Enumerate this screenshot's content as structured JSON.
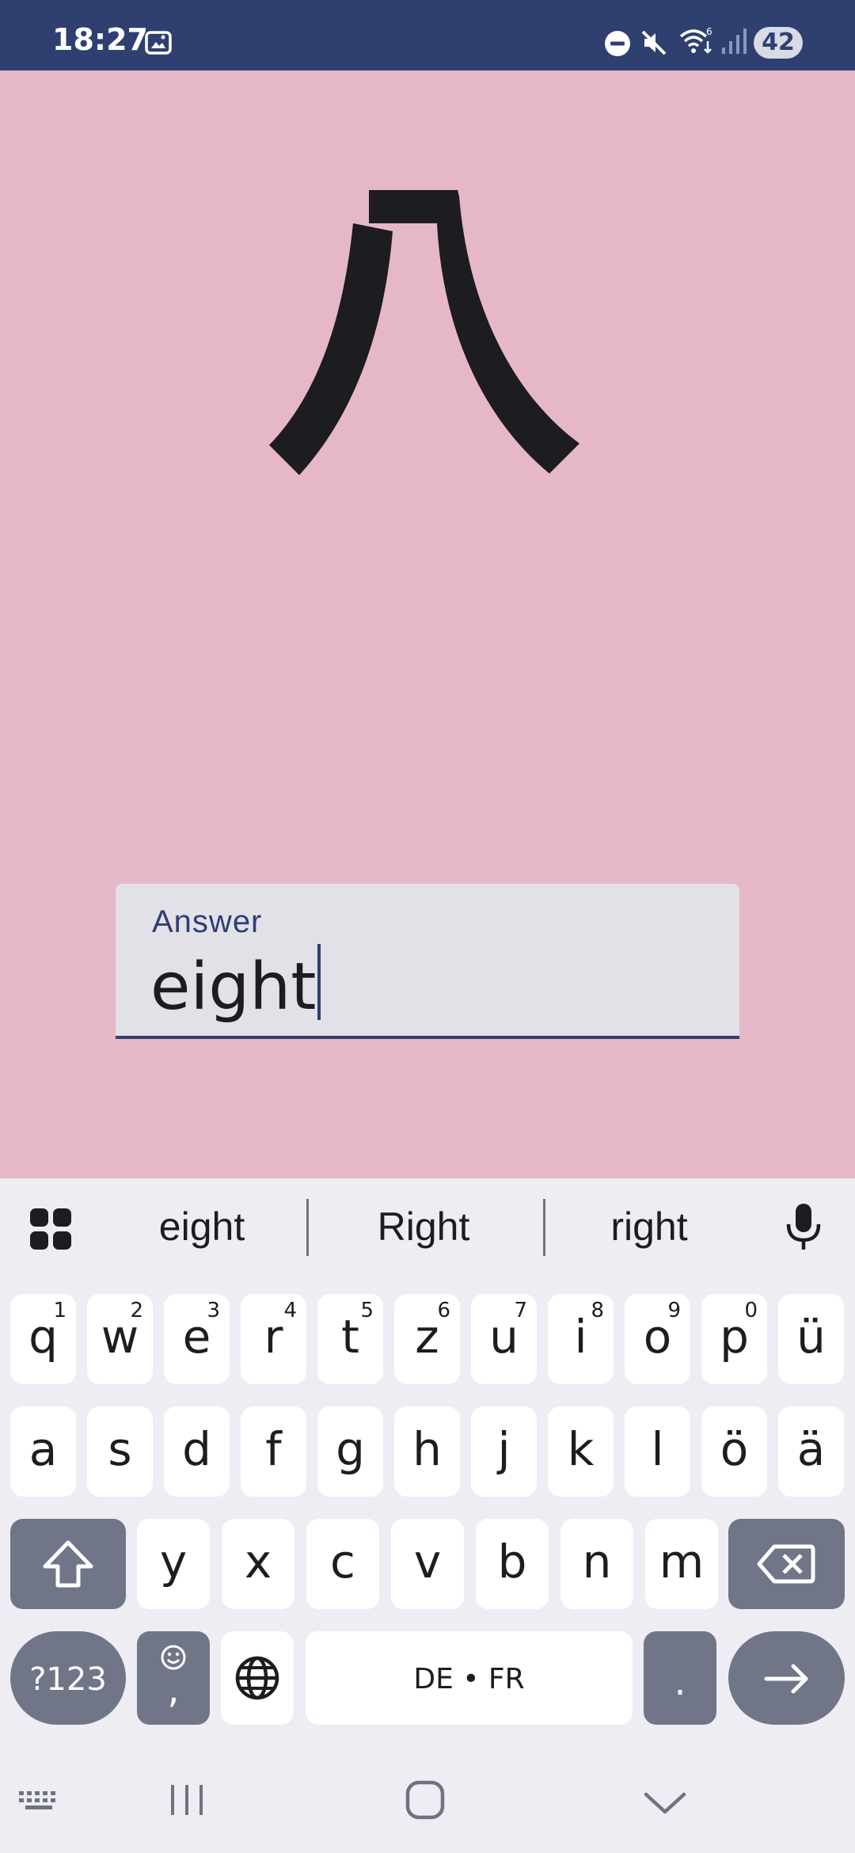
{
  "status": {
    "time": "18:27",
    "battery": "42",
    "icons": [
      "screenshot-icon",
      "dnd-icon",
      "mute-icon",
      "wifi-icon",
      "signal-icon"
    ]
  },
  "card": {
    "kanji": "八"
  },
  "answer": {
    "label": "Answer",
    "value": "eight"
  },
  "keyboard": {
    "suggestions": [
      "eight",
      "Right",
      "right"
    ],
    "row1": [
      {
        "k": "q",
        "s": "1"
      },
      {
        "k": "w",
        "s": "2"
      },
      {
        "k": "e",
        "s": "3"
      },
      {
        "k": "r",
        "s": "4"
      },
      {
        "k": "t",
        "s": "5"
      },
      {
        "k": "z",
        "s": "6"
      },
      {
        "k": "u",
        "s": "7"
      },
      {
        "k": "i",
        "s": "8"
      },
      {
        "k": "o",
        "s": "9"
      },
      {
        "k": "p",
        "s": "0"
      },
      {
        "k": "ü",
        "s": ""
      }
    ],
    "row2": [
      "a",
      "s",
      "d",
      "f",
      "g",
      "h",
      "j",
      "k",
      "l",
      "ö",
      "ä"
    ],
    "row3": [
      "y",
      "x",
      "c",
      "v",
      "b",
      "n",
      "m"
    ],
    "symbols_label": "?123",
    "comma_label": ",",
    "space_label": "DE • FR",
    "period_label": "."
  },
  "colors": {
    "accent": "#2e3f70",
    "background": "#e6b8c7",
    "key_dark": "#707588"
  }
}
